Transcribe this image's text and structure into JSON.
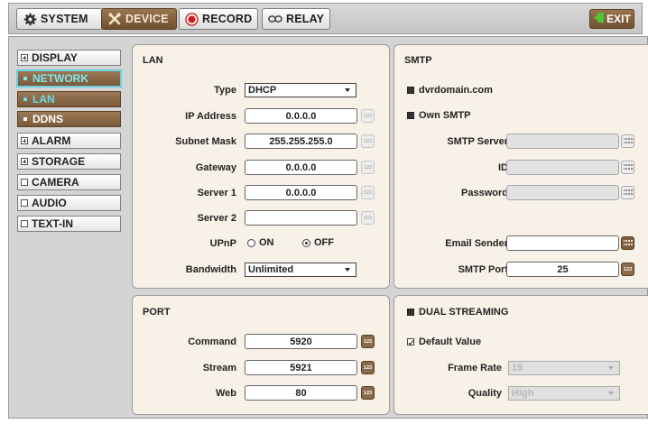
{
  "topbar": {
    "tabs": [
      {
        "label": "SYSTEM",
        "icon": "gear-icon"
      },
      {
        "label": "DEVICE",
        "icon": "tools-icon"
      },
      {
        "label": "RECORD",
        "icon": "record-icon"
      },
      {
        "label": "RELAY",
        "icon": "relay-icon"
      }
    ],
    "exit_label": "EXIT",
    "active_tab": "DEVICE"
  },
  "menu": {
    "items": [
      {
        "label": "DISPLAY"
      },
      {
        "label": "NETWORK"
      },
      {
        "label": "LAN"
      },
      {
        "label": "DDNS"
      },
      {
        "label": "ALARM"
      },
      {
        "label": "STORAGE"
      },
      {
        "label": "CAMERA"
      },
      {
        "label": "AUDIO"
      },
      {
        "label": "TEXT-IN"
      }
    ],
    "selected": "LAN"
  },
  "lan": {
    "title": "LAN",
    "type_label": "Type",
    "type_value": "DHCP",
    "ip_label": "IP Address",
    "ip_value": "0.0.0.0",
    "subnet_label": "Subnet Mask",
    "subnet_value": "255.255.255.0",
    "gateway_label": "Gateway",
    "gateway_value": "0.0.0.0",
    "server1_label": "Server 1",
    "server1_value": "0.0.0.0",
    "server2_label": "Server 2",
    "server2_value": "",
    "upnp_label": "UPnP",
    "upnp_on": "ON",
    "upnp_off": "OFF",
    "bandwidth_label": "Bandwidth",
    "bandwidth_value": "Unlimited",
    "numpad_glyph": "123"
  },
  "smtp": {
    "title": "SMTP",
    "option_domain": "dvrdomain.com",
    "option_own": "Own SMTP",
    "server_label": "SMTP Server",
    "server_value": "",
    "id_label": "ID",
    "id_value": "",
    "password_label": "Password",
    "password_value": "",
    "sender_label": "Email Sender",
    "sender_value": "",
    "port_label": "SMTP Port",
    "port_value": "25"
  },
  "port": {
    "title": "PORT",
    "command_label": "Command",
    "command_value": "5920",
    "stream_label": "Stream",
    "stream_value": "5921",
    "web_label": "Web",
    "web_value": "80"
  },
  "dual": {
    "title": "DUAL STREAMING",
    "default_label": "Default Value",
    "framerate_label": "Frame Rate",
    "framerate_value": "15",
    "quality_label": "Quality",
    "quality_value": "High"
  },
  "colors": {
    "accent_brown": "#7d5e3e",
    "panel_bg": "#f7f1e8",
    "selected_cyan": "#7fe7ee"
  }
}
